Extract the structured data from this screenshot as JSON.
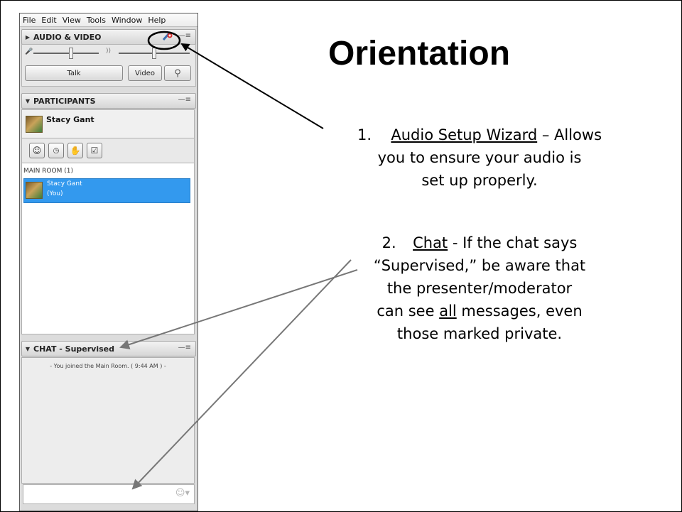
{
  "menubar": {
    "items": [
      "File",
      "Edit",
      "View",
      "Tools",
      "Window",
      "Help"
    ]
  },
  "audio_video": {
    "title": "AUDIO & VIDEO",
    "talk_label": "Talk",
    "video_label": "Video"
  },
  "participants": {
    "title": "PARTICIPANTS",
    "current_user": "Stacy Gant",
    "room_label": "MAIN ROOM (1)",
    "list": [
      {
        "name": "Stacy Gant",
        "note": "(You)"
      }
    ]
  },
  "chat": {
    "title": "CHAT - Supervised",
    "message": "- You joined the Main Room. ( 9:44 AM ) -"
  },
  "slide": {
    "title": "Orientation",
    "item1": {
      "number": "1.",
      "link": "Audio Setup Wizard",
      "text_a": " – Allows",
      "line2": "you to ensure your audio is",
      "line3": "set up properly."
    },
    "item2": {
      "number": "2.",
      "link": "Chat",
      "text_a": " - If the chat says",
      "line2": "“Supervised,” be aware that",
      "line3": "the presenter/moderator",
      "line4_a": "can see ",
      "line4_u": "all",
      "line4_b": " messages, even",
      "line5": "those marked private."
    }
  }
}
